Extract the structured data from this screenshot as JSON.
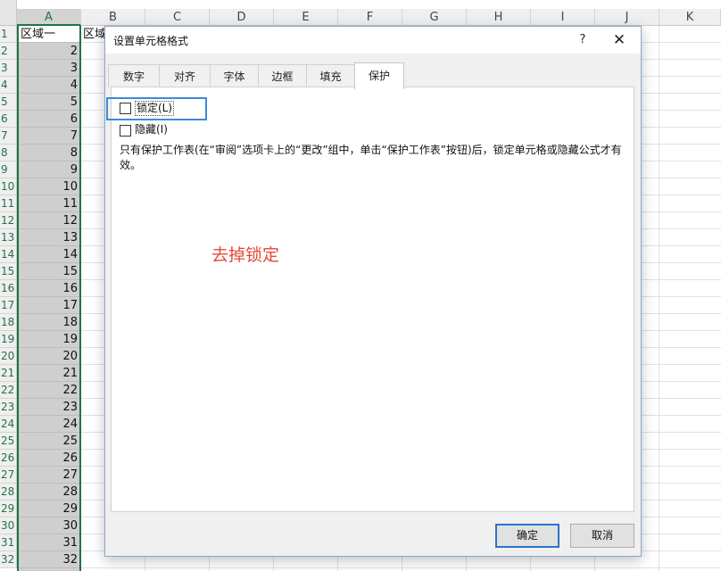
{
  "sheet": {
    "columns": [
      "A",
      "B",
      "C",
      "D",
      "E",
      "F",
      "G",
      "H",
      "I",
      "J",
      "K"
    ],
    "rows": [
      "1",
      "2",
      "3",
      "4",
      "5",
      "6",
      "7",
      "8",
      "9",
      "10",
      "11",
      "12",
      "13",
      "14",
      "15",
      "16",
      "17",
      "18",
      "19",
      "20",
      "21",
      "22",
      "23",
      "24",
      "25",
      "26",
      "27",
      "28",
      "29",
      "30",
      "31",
      "32"
    ],
    "colA_header": "区域一",
    "colA_values": [
      "2",
      "3",
      "4",
      "5",
      "6",
      "7",
      "8",
      "9",
      "10",
      "11",
      "12",
      "13",
      "14",
      "15",
      "16",
      "17",
      "18",
      "19",
      "20",
      "21",
      "22",
      "23",
      "24",
      "25",
      "26",
      "27",
      "28",
      "29",
      "30",
      "31",
      "32"
    ],
    "colB_partial": "区域"
  },
  "dialog": {
    "title": "设置单元格格式",
    "help": "?",
    "close": "✕",
    "tabs": [
      "数字",
      "对齐",
      "字体",
      "边框",
      "填充",
      "保护"
    ],
    "active_tab": "保护",
    "lock_label": "锁定(L)",
    "lock_checked": false,
    "hide_label": "隐藏(I)",
    "hide_checked": false,
    "note": "只有保护工作表(在“审阅”选项卡上的“更改”组中，单击“保护工作表”按钮)后，锁定单元格或隐藏公式才有效。",
    "ok": "确定",
    "cancel": "取消"
  },
  "annotation": {
    "text": "去掉锁定",
    "color": "#e4483a"
  },
  "colors": {
    "excel_green": "#217346",
    "highlight_blue": "#3c8ad8"
  }
}
